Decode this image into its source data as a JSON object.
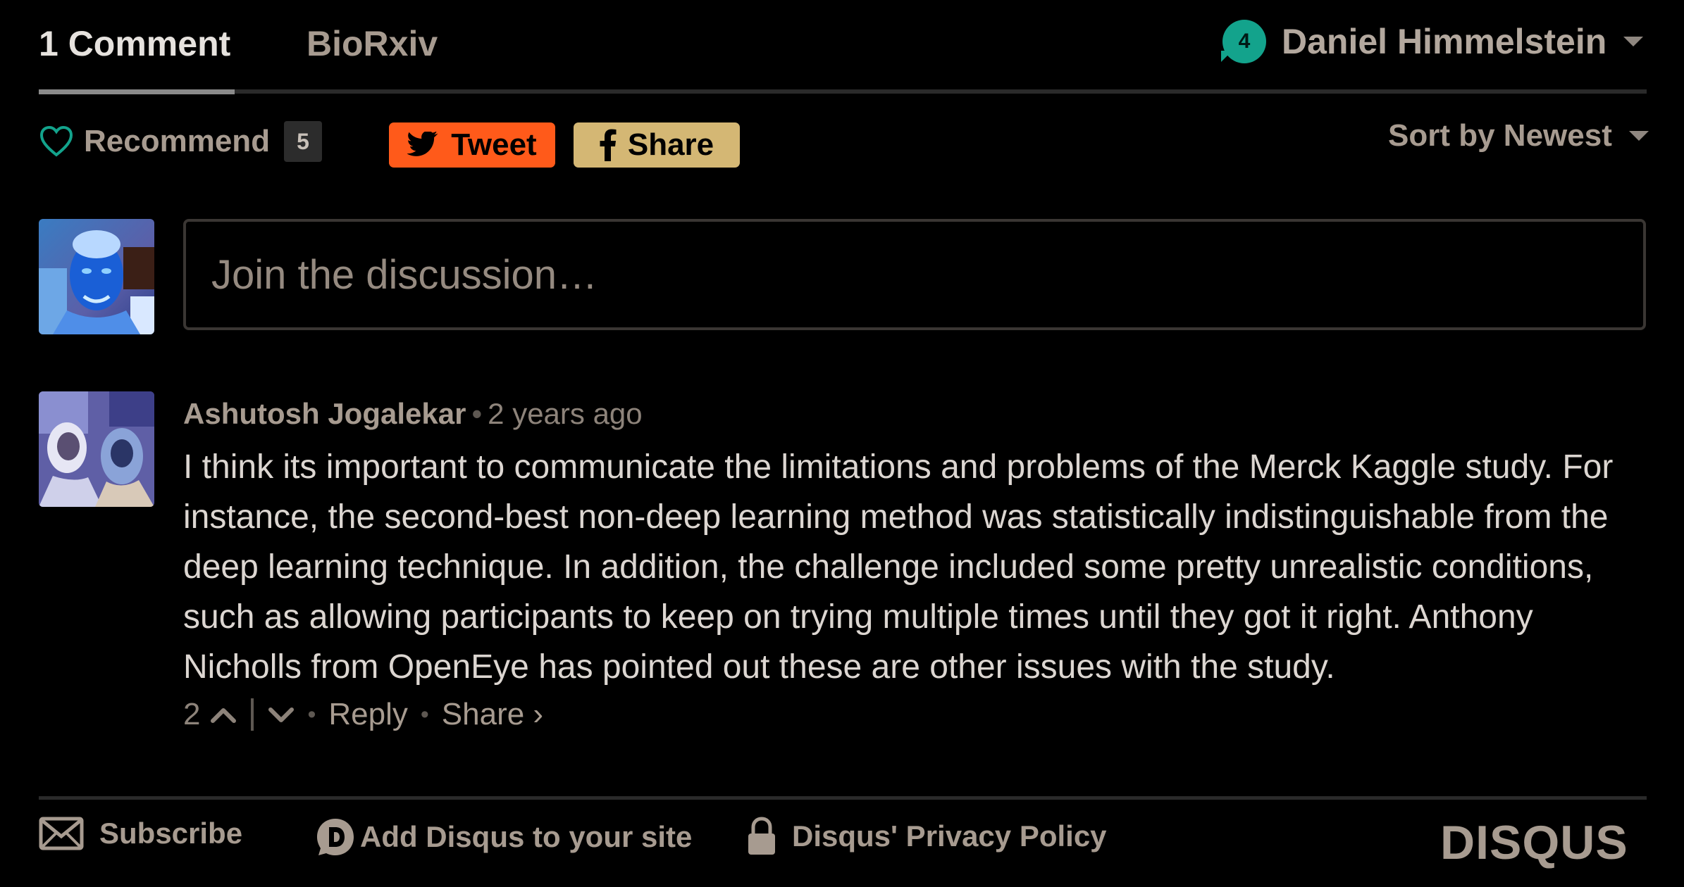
{
  "header": {
    "tab_comments": "1 Comment",
    "tab_forum": "BioRxiv",
    "notification_count": "4",
    "user_name": "Daniel Himmelstein"
  },
  "actions": {
    "recommend_label": "Recommend",
    "recommend_count": "5",
    "tweet_label": "Tweet",
    "share_label": "Share",
    "sort_label": "Sort by Newest"
  },
  "composer": {
    "placeholder": "Join the discussion…"
  },
  "comment": {
    "author": "Ashutosh Jogalekar",
    "separator": "•",
    "time": "2 years ago",
    "body": "I think its important to communicate the limitations and problems of the Merck Kaggle study. For instance, the second-best non-deep learning method was statistically indistinguishable from the deep learning technique. In addition, the challenge included some pretty unrealistic conditions, such as allowing participants to keep on trying multiple times until they got it right. Anthony Nicholls from OpenEye has pointed out these are other issues with the study.",
    "votes": "2",
    "reply_label": "Reply",
    "share_label": "Share ›"
  },
  "footer": {
    "subscribe_label": "Subscribe",
    "add_disqus_label": "Add Disqus to your site",
    "privacy_label": "Disqus' Privacy Policy",
    "logo_text": "DISQUS"
  },
  "colors": {
    "background": "#000000",
    "tweet": "#ff5a1a",
    "share": "#d4b774",
    "badge": "#13a38c",
    "muted_text": "#a79b90"
  }
}
